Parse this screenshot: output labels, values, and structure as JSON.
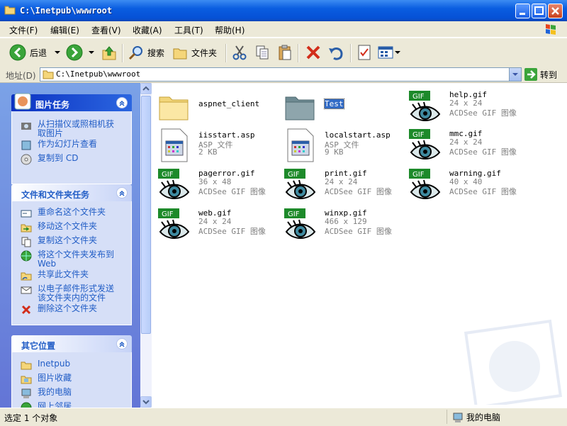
{
  "window": {
    "title": "C:\\Inetpub\\wwwroot"
  },
  "menu": [
    "文件(F)",
    "编辑(E)",
    "查看(V)",
    "收藏(A)",
    "工具(T)",
    "帮助(H)"
  ],
  "toolbar": {
    "back": "后退",
    "search": "搜索",
    "folders": "文件夹"
  },
  "address": {
    "label": "地址(D)",
    "value": "C:\\Inetpub\\wwwroot",
    "go": "转到"
  },
  "left_pane": {
    "picture_tasks": {
      "title": "图片任务",
      "items": [
        "从扫描仪或照相机获取图片",
        "作为幻灯片查看",
        "复制到 CD"
      ]
    },
    "file_tasks": {
      "title": "文件和文件夹任务",
      "items": [
        "重命名这个文件夹",
        "移动这个文件夹",
        "复制这个文件夹",
        "将这个文件夹发布到 Web",
        "共享此文件夹",
        "以电子邮件形式发送该文件夹内的文件",
        "删除这个文件夹"
      ]
    },
    "other_places": {
      "title": "其它位置",
      "items": [
        "Inetpub",
        "图片收藏",
        "我的电脑",
        "网上邻居"
      ]
    }
  },
  "files": [
    {
      "name": "aspnet_client",
      "type": "folder"
    },
    {
      "name": "Test",
      "type": "folder-selected"
    },
    {
      "name": "help.gif",
      "dims": "24 x 24",
      "kind": "ACDSee GIF 图像"
    },
    {
      "name": "iisstart.asp",
      "dims": "ASP 文件",
      "kind": "2 KB"
    },
    {
      "name": "localstart.asp",
      "dims": "ASP 文件",
      "kind": "9 KB"
    },
    {
      "name": "mmc.gif",
      "dims": "24 x 24",
      "kind": "ACDSee GIF 图像"
    },
    {
      "name": "pagerror.gif",
      "dims": "36 x 48",
      "kind": "ACDSee GIF 图像"
    },
    {
      "name": "print.gif",
      "dims": "24 x 24",
      "kind": "ACDSee GIF 图像"
    },
    {
      "name": "warning.gif",
      "dims": "40 x 40",
      "kind": "ACDSee GIF 图像"
    },
    {
      "name": "web.gif",
      "dims": "24 x 24",
      "kind": "ACDSee GIF 图像"
    },
    {
      "name": "winxp.gif",
      "dims": "466 x 129",
      "kind": "ACDSee GIF 图像"
    }
  ],
  "gif_badge": "GIF",
  "status": {
    "text": "选定 1 个对象",
    "zone": "我的电脑"
  }
}
